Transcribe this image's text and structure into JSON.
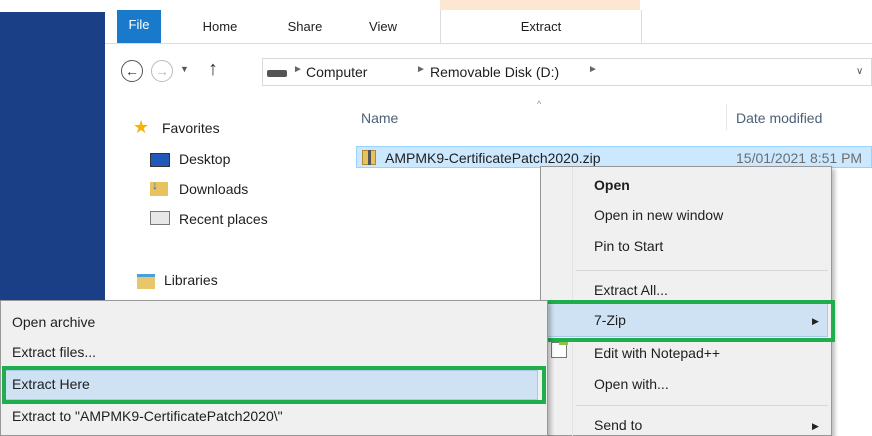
{
  "ribbon": {
    "tabs": [
      "File",
      "Home",
      "Share",
      "View",
      "Extract"
    ]
  },
  "address": {
    "crumbs": [
      "Computer",
      "Removable Disk (D:)"
    ]
  },
  "nav": {
    "favorites": "Favorites",
    "desktop": "Desktop",
    "downloads": "Downloads",
    "recent": "Recent places",
    "libraries": "Libraries"
  },
  "columns": {
    "name": "Name",
    "date": "Date modified"
  },
  "file": {
    "name": "AMPMK9-CertificatePatch2020.zip",
    "date": "15/01/2021 8:51 PM"
  },
  "context_menu": {
    "open": "Open",
    "open_new": "Open in new window",
    "pin": "Pin to Start",
    "extract_all": "Extract All...",
    "sevenzip": "7-Zip",
    "notepad": "Edit with Notepad++",
    "open_with": "Open with...",
    "send_to": "Send to"
  },
  "submenu": {
    "open_archive": "Open archive",
    "extract_files": "Extract files...",
    "extract_here": "Extract Here",
    "extract_to": "Extract to \"AMPMK9-CertificatePatch2020\\\""
  },
  "colors": {
    "highlight_box": "#1fae4b",
    "selection": "#cce8ff",
    "file_tab": "#1979ca"
  }
}
